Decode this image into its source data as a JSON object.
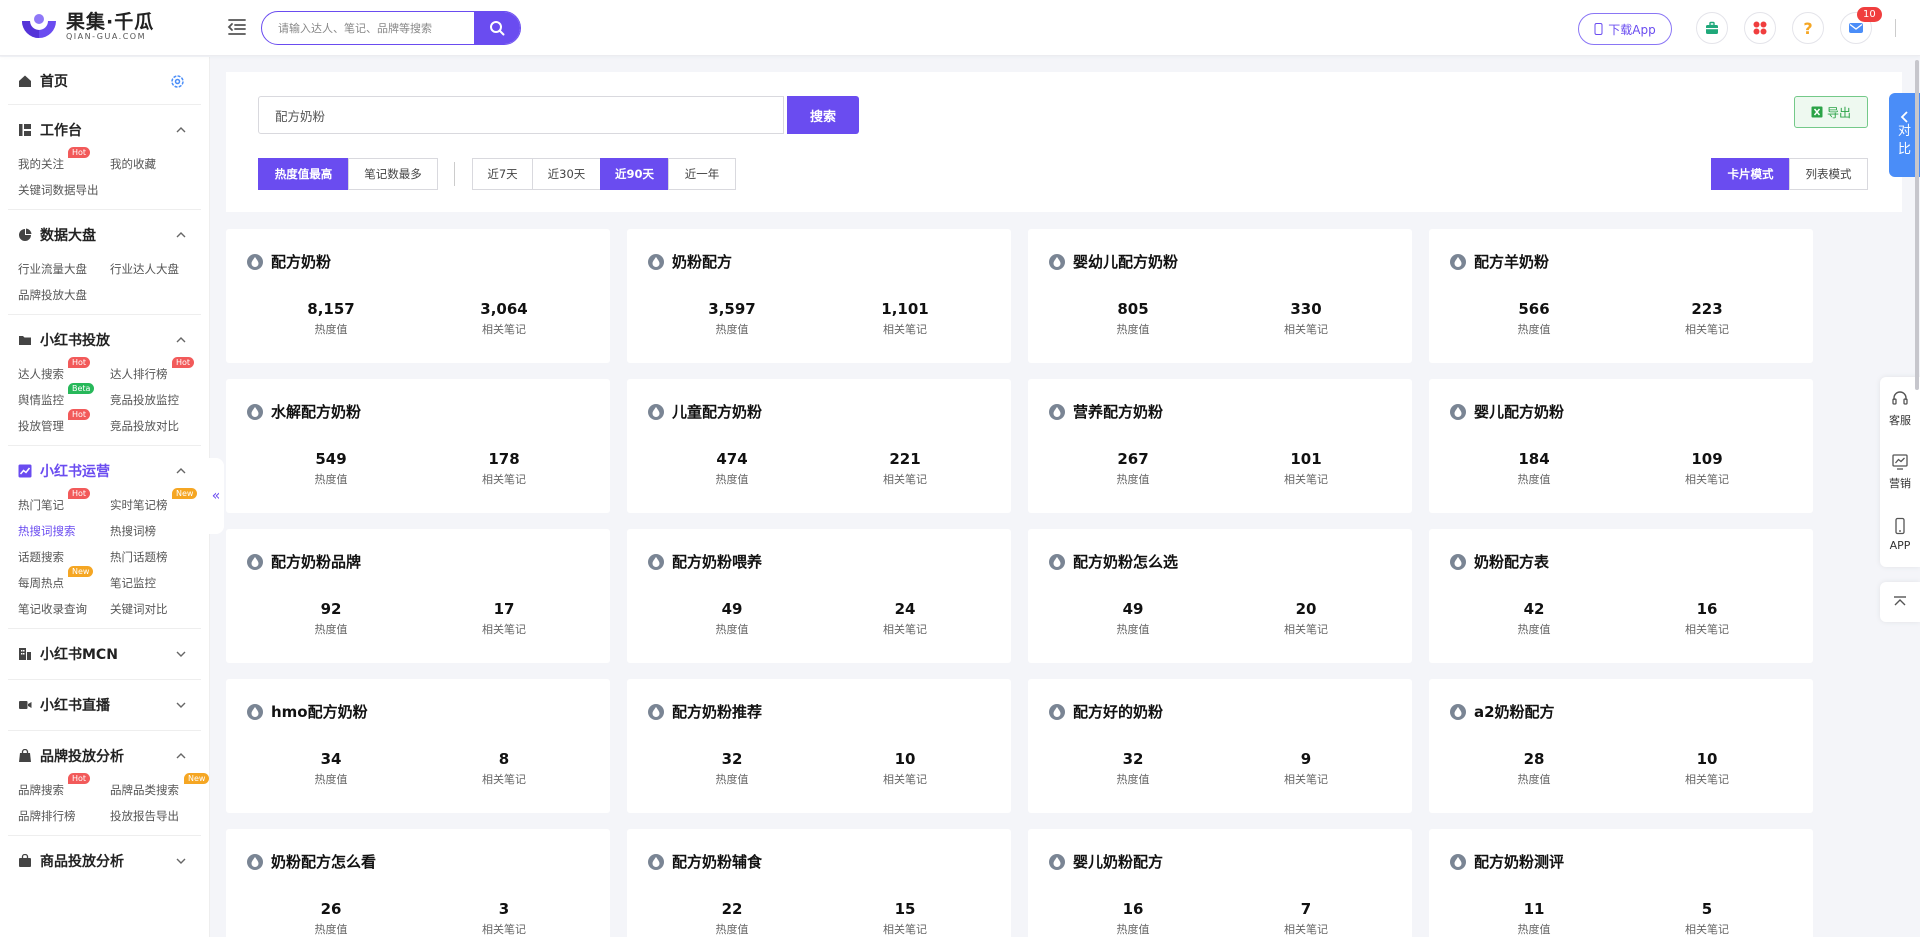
{
  "header": {
    "logo_cn": "果集·千瓜",
    "logo_en": "QIAN-GUA.COM",
    "search_placeholder": "请输入达人、笔记、品牌等搜索",
    "download_label": "下载App",
    "notification_count": "10",
    "icons": [
      "menu-collapse-icon",
      "search-icon",
      "phone-icon",
      "briefcase-icon",
      "apps-icon",
      "help-icon",
      "mail-icon"
    ]
  },
  "sidebar": {
    "home": "首页",
    "sections": [
      {
        "title": "工作台",
        "icon": "monitor-icon",
        "expanded": true,
        "items": [
          {
            "label": "我的关注",
            "tag": "Hot"
          },
          {
            "label": "我的收藏",
            "tag": ""
          },
          {
            "label": "关键词数据导出",
            "tag": ""
          }
        ]
      },
      {
        "title": "数据大盘",
        "icon": "pie-chart-icon",
        "expanded": true,
        "items": [
          {
            "label": "行业流量大盘",
            "tag": ""
          },
          {
            "label": "行业达人大盘",
            "tag": ""
          },
          {
            "label": "品牌投放大盘",
            "tag": ""
          }
        ]
      },
      {
        "title": "小红书投放",
        "icon": "folder-icon",
        "expanded": true,
        "items": [
          {
            "label": "达人搜索",
            "tag": "Hot"
          },
          {
            "label": "达人排行榜",
            "tag": "Hot"
          },
          {
            "label": "舆情监控",
            "tag": "Beta"
          },
          {
            "label": "竞品投放监控",
            "tag": ""
          },
          {
            "label": "投放管理",
            "tag": "Hot"
          },
          {
            "label": "竞品投放对比",
            "tag": ""
          }
        ]
      },
      {
        "title": "小红书运营",
        "icon": "trend-icon",
        "expanded": true,
        "active": true,
        "items": [
          {
            "label": "热门笔记",
            "tag": "Hot"
          },
          {
            "label": "实时笔记榜",
            "tag": "New"
          },
          {
            "label": "热搜词搜索",
            "tag": "",
            "active": true
          },
          {
            "label": "热搜词榜",
            "tag": ""
          },
          {
            "label": "话题搜索",
            "tag": ""
          },
          {
            "label": "热门话题榜",
            "tag": ""
          },
          {
            "label": "每周热点",
            "tag": "New"
          },
          {
            "label": "笔记监控",
            "tag": ""
          },
          {
            "label": "笔记收录查询",
            "tag": ""
          },
          {
            "label": "关键词对比",
            "tag": ""
          }
        ]
      },
      {
        "title": "小红书MCN",
        "icon": "building-icon",
        "expanded": false,
        "items": []
      },
      {
        "title": "小红书直播",
        "icon": "video-icon",
        "expanded": false,
        "items": []
      },
      {
        "title": "品牌投放分析",
        "icon": "shopping-bag-icon",
        "expanded": true,
        "items": [
          {
            "label": "品牌搜索",
            "tag": "Hot"
          },
          {
            "label": "品牌品类搜索",
            "tag": "New"
          },
          {
            "label": "品牌排行榜",
            "tag": ""
          },
          {
            "label": "投放报告导出",
            "tag": ""
          }
        ]
      },
      {
        "title": "商品投放分析",
        "icon": "bag-icon",
        "expanded": false,
        "items": []
      }
    ]
  },
  "filters": {
    "keyword": "配方奶粉",
    "search_button": "搜索",
    "export_label": "导出",
    "sort_options": [
      "热度值最高",
      "笔记数最多"
    ],
    "sort_selected": "热度值最高",
    "period_options": [
      "近7天",
      "近30天",
      "近90天",
      "近一年"
    ],
    "period_selected": "近90天",
    "view_options": [
      "卡片模式",
      "列表模式"
    ],
    "view_selected": "卡片模式"
  },
  "stat_labels": {
    "heat": "热度值",
    "notes": "相关笔记"
  },
  "cards": [
    {
      "keyword": "配方奶粉",
      "heat": "8,157",
      "notes": "3,064"
    },
    {
      "keyword": "奶粉配方",
      "heat": "3,597",
      "notes": "1,101"
    },
    {
      "keyword": "婴幼儿配方奶粉",
      "heat": "805",
      "notes": "330"
    },
    {
      "keyword": "配方羊奶粉",
      "heat": "566",
      "notes": "223"
    },
    {
      "keyword": "水解配方奶粉",
      "heat": "549",
      "notes": "178"
    },
    {
      "keyword": "儿童配方奶粉",
      "heat": "474",
      "notes": "221"
    },
    {
      "keyword": "营养配方奶粉",
      "heat": "267",
      "notes": "101"
    },
    {
      "keyword": "婴儿配方奶粉",
      "heat": "184",
      "notes": "109"
    },
    {
      "keyword": "配方奶粉品牌",
      "heat": "92",
      "notes": "17"
    },
    {
      "keyword": "配方奶粉喂养",
      "heat": "49",
      "notes": "24"
    },
    {
      "keyword": "配方奶粉怎么选",
      "heat": "49",
      "notes": "20"
    },
    {
      "keyword": "奶粉配方表",
      "heat": "42",
      "notes": "16"
    },
    {
      "keyword": "hmo配方奶粉",
      "heat": "34",
      "notes": "8"
    },
    {
      "keyword": "配方奶粉推荐",
      "heat": "32",
      "notes": "10"
    },
    {
      "keyword": "配方好的奶粉",
      "heat": "32",
      "notes": "9"
    },
    {
      "keyword": "a2奶粉配方",
      "heat": "28",
      "notes": "10"
    },
    {
      "keyword": "奶粉配方怎么看",
      "heat": "26",
      "notes": "3"
    },
    {
      "keyword": "配方奶粉辅食",
      "heat": "22",
      "notes": "15"
    },
    {
      "keyword": "婴儿奶粉配方",
      "heat": "16",
      "notes": "7"
    },
    {
      "keyword": "配方奶粉测评",
      "heat": "11",
      "notes": "5"
    }
  ],
  "float": {
    "compare": [
      "对",
      "比"
    ],
    "items": [
      "客服",
      "营销",
      "APP"
    ]
  },
  "colors": {
    "accent": "#6a4cf0",
    "hot": "#f25a5a",
    "new": "#f5a623",
    "beta": "#27b85a",
    "compare": "#4a8df8",
    "export": "#2ba347"
  }
}
